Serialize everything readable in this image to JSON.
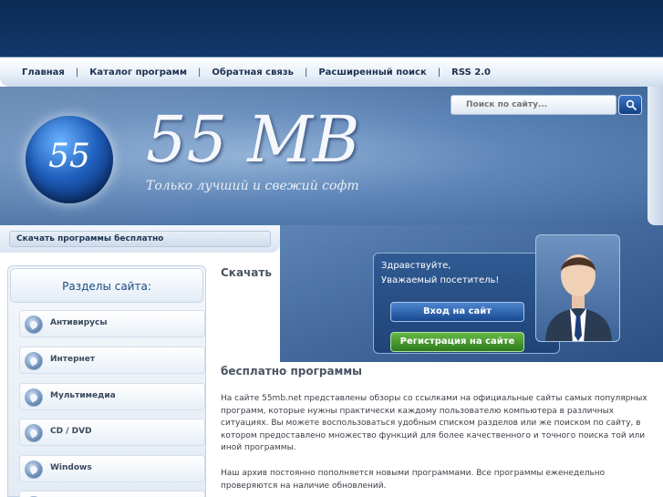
{
  "nav": {
    "items": [
      "Главная",
      "Каталог программ",
      "Обратная связь",
      "Расширенный поиск",
      "RSS 2.0"
    ],
    "separator": "|"
  },
  "header": {
    "orb_text": "55",
    "title": "55 MB",
    "slogan": "Только лучший и свежий софт"
  },
  "search": {
    "placeholder": "Поиск по сайту...",
    "button_icon": "search-icon"
  },
  "breadcrumb": {
    "text": "Скачать программы бесплатно"
  },
  "welcome": {
    "greeting": "Здравствуйте,",
    "visitor": "Уважаемый посетитель!",
    "login_label": "Вход на сайт",
    "register_label": "Регистрация на сайте"
  },
  "sidebar": {
    "title": "Разделы сайта:",
    "items": [
      {
        "label": "Антивирусы",
        "icon": "category-icon"
      },
      {
        "label": "Интернет",
        "icon": "category-icon"
      },
      {
        "label": "Мультимедиа",
        "icon": "category-icon"
      },
      {
        "label": "CD / DVD",
        "icon": "category-icon"
      },
      {
        "label": "Windows",
        "icon": "category-icon"
      }
    ]
  },
  "content": {
    "heading_part1": "Скачать",
    "heading_part2": "бесплатно программы",
    "paragraph1": "На сайте 55mb.net представлены обзоры со ссылками на официальные сайты самых популярных программ, которые нужны практически каждому пользователю компьютера в различных ситуациях. Вы можете воспользоваться удобным списком разделов или же поиском по сайту, в котором предоставлено множество функций для более качественного и точного поиска той или иной программы.",
    "paragraph2": "Наш архив постоянно пополняется новыми программами. Все программы еженедельно проверяются на наличие обновлений."
  },
  "colors": {
    "top_bar": "#0c2b55",
    "header_blue": "#5e86b8",
    "login_button": "#17488f",
    "register_button": "#2d7a1e",
    "sidebar_title": "#1b4a80"
  }
}
